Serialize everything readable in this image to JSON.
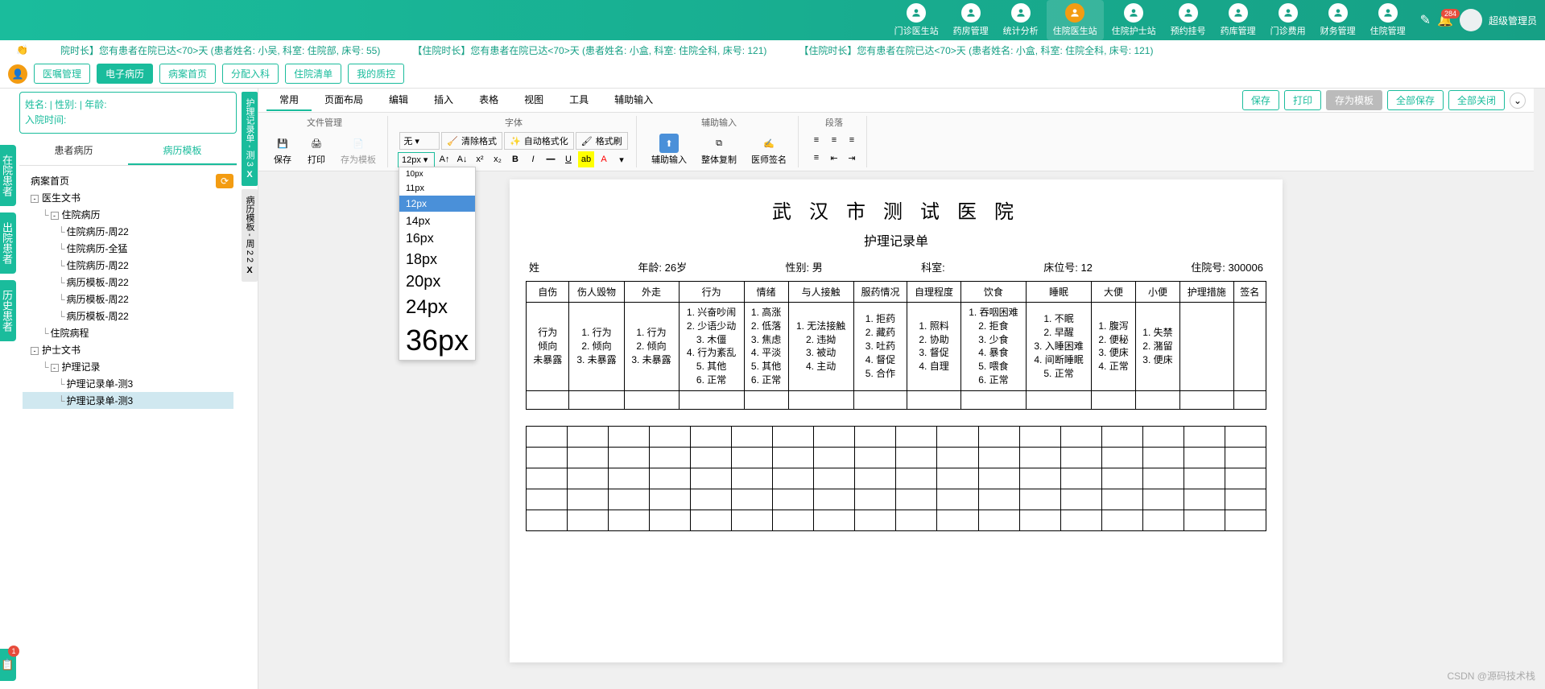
{
  "nav": {
    "items": [
      {
        "label": "门诊医生站"
      },
      {
        "label": "药房管理"
      },
      {
        "label": "统计分析"
      },
      {
        "label": "住院医生站",
        "active": true
      },
      {
        "label": "住院护士站"
      },
      {
        "label": "预约挂号"
      },
      {
        "label": "药库管理"
      },
      {
        "label": "门诊费用"
      },
      {
        "label": "财务管理"
      },
      {
        "label": "住院管理"
      }
    ],
    "badge": "284",
    "user": "超级管理员"
  },
  "notifications": [
    "院时长】您有患者在院已达<70>天 (患者姓名: 小吴,   科室: 住院部, 床号: 55)",
    "【住院时长】您有患者在院已达<70>天 (患者姓名: 小盒,   科室: 住院全科, 床号: 121)",
    "【住院时长】您有患者在院已达<70>天 (患者姓名: 小盒,   科室: 住院全科, 床号: 121)"
  ],
  "toolbar": {
    "buttons": [
      {
        "label": "医嘱管理"
      },
      {
        "label": "电子病历",
        "active": true
      },
      {
        "label": "病案首页"
      },
      {
        "label": "分配入科"
      },
      {
        "label": "住院清单"
      },
      {
        "label": "我的质控"
      }
    ]
  },
  "sideTabs": [
    "在院患者",
    "出院患者",
    "历史患者"
  ],
  "sideBottomBadge": "1",
  "patientInfo": {
    "name_label": "姓名:",
    "sex_label": "| 性别:",
    "age_label": "| 年龄:",
    "admit_label": "入院时间:"
  },
  "treeTabs": {
    "left": "患者病历",
    "right": "病历模板"
  },
  "tree": [
    {
      "level": 0,
      "label": "病案首页",
      "toggle": "",
      "refresh": true
    },
    {
      "level": 0,
      "label": "医生文书",
      "toggle": "-"
    },
    {
      "level": 1,
      "label": "住院病历",
      "toggle": "-"
    },
    {
      "level": 2,
      "label": "住院病历-周22"
    },
    {
      "level": 2,
      "label": "住院病历-全猛"
    },
    {
      "level": 2,
      "label": "住院病历-周22"
    },
    {
      "level": 2,
      "label": "病历模板-周22"
    },
    {
      "level": 2,
      "label": "病历模板-周22"
    },
    {
      "level": 2,
      "label": "病历模板-周22"
    },
    {
      "level": 1,
      "label": "住院病程"
    },
    {
      "level": 0,
      "label": "护士文书",
      "toggle": "-"
    },
    {
      "level": 1,
      "label": "护理记录",
      "toggle": "-"
    },
    {
      "level": 2,
      "label": "护理记录单-测3"
    },
    {
      "level": 2,
      "label": "护理记录单-测3",
      "selected": true
    }
  ],
  "vdocTabs": [
    {
      "label": "护理记录单 - 测 3",
      "close": "X",
      "active": true
    },
    {
      "label": "病历模板 - 周 2 2",
      "close": "X"
    }
  ],
  "editorMenu": {
    "items": [
      "常用",
      "页面布局",
      "编辑",
      "插入",
      "表格",
      "视图",
      "工具",
      "辅助输入"
    ],
    "activeIndex": 0,
    "right": [
      {
        "label": "保存"
      },
      {
        "label": "打印"
      },
      {
        "label": "存为模板",
        "gray": true
      },
      {
        "label": "全部保存"
      },
      {
        "label": "全部关闭"
      }
    ]
  },
  "ribbon": {
    "groups": {
      "file": {
        "title": "文件管理",
        "buttons": [
          "保存",
          "打印",
          "存为模板"
        ]
      },
      "font": {
        "title": "字体",
        "fontFamily": "无",
        "fontSize": "12px",
        "topBtns": [
          "清除格式",
          "自动格式化",
          "格式刷"
        ]
      },
      "assist": {
        "title": "辅助输入",
        "buttons": [
          "辅助输入",
          "整体复制",
          "医师签名"
        ]
      },
      "para": {
        "title": "段落"
      }
    }
  },
  "fontSizes": [
    "10px",
    "11px",
    "12px",
    "14px",
    "16px",
    "18px",
    "20px",
    "24px",
    "36px"
  ],
  "fontSizeSelected": "12px",
  "doc": {
    "hospital": "武 汉 市 测 试 医 院",
    "subtitle": "护理记录单",
    "info": {
      "name_label": "姓",
      "age_label": "年龄:",
      "age": "26岁",
      "sex_label": "性别:",
      "sex": "男",
      "dept_label": "科室:",
      "bed_label": "床位号:",
      "bed": "12",
      "inpatient_label": "住院号:",
      "inpatient": "300006"
    },
    "headers": [
      "自伤",
      "伤人毁物",
      "外走",
      "行为",
      "情绪",
      "与人接触",
      "服药情况",
      "自理程度",
      "饮食",
      "睡眠",
      "大便",
      "小便",
      "护理措施",
      "签名"
    ],
    "row1": [
      "行为\n倾向\n未暴露",
      "1. 行为\n2. 倾向\n3. 未暴露",
      "1. 行为\n2. 倾向\n3. 未暴露",
      "1. 兴奋吵闹\n2. 少语少动\n3. 木僵\n4. 行为紊乱\n5. 其他\n6. 正常",
      "1. 高涨\n2. 低落\n3. 焦虑\n4. 平淡\n5. 其他\n6. 正常",
      "1. 无法接触\n2. 违拗\n3. 被动\n4. 主动",
      "1. 拒药\n2. 藏药\n3. 吐药\n4. 督促\n5. 合作",
      "1. 照料\n2. 协助\n3. 督促\n4. 自理",
      "1. 吞咽困难\n2. 拒食\n3. 少食\n4. 暴食\n5. 喂食\n6. 正常",
      "1. 不眠\n2. 早醒\n3. 入睡困难\n4. 间断睡眠\n5. 正常",
      "1. 腹泻\n2. 便秘\n3. 便床\n4. 正常",
      "1. 失禁\n2. 潴留\n3. 便床\n",
      "",
      ""
    ]
  },
  "watermark": "CSDN @源码技术栈"
}
